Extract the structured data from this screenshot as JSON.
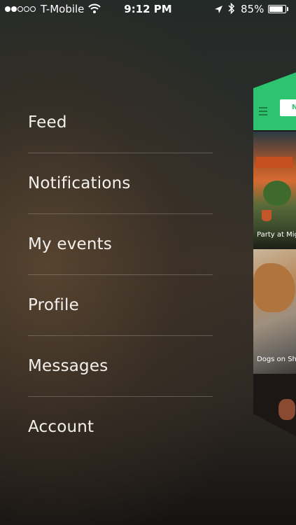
{
  "status_bar": {
    "signal_dots_filled": 2,
    "signal_dots_total": 5,
    "carrier": "T-Mobile",
    "time": "9:12 PM",
    "battery_percent": "85%",
    "battery_level": 0.85,
    "icons": [
      "signal-dots",
      "wifi-icon",
      "location-arrow-icon",
      "bluetooth-icon",
      "battery-icon"
    ]
  },
  "menu": {
    "items": [
      {
        "label": "Feed"
      },
      {
        "label": "Notifications"
      },
      {
        "label": "My events"
      },
      {
        "label": "Profile"
      },
      {
        "label": "Messages"
      },
      {
        "label": "Account"
      }
    ]
  },
  "preview": {
    "header_color": "#2ec46f",
    "tab_letter": "N",
    "cards": [
      {
        "caption": "Party at Migu"
      },
      {
        "caption": "Dogs on Shag"
      },
      {
        "caption": ""
      }
    ]
  }
}
